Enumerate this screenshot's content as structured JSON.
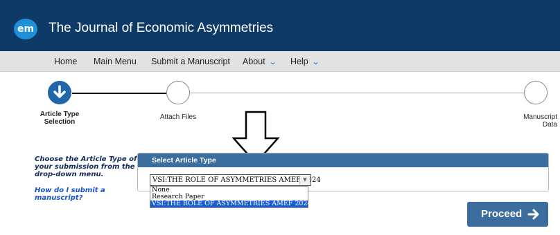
{
  "header": {
    "logo_text": "em",
    "journal_title": "The Journal of Economic Asymmetries",
    "bg_color": "#0d3a66"
  },
  "nav": {
    "items": [
      {
        "label": "Home"
      },
      {
        "label": "Main Menu"
      },
      {
        "label": "Submit a Manuscript"
      },
      {
        "label": "About",
        "icon": "chevron-down-icon"
      },
      {
        "label": "Help",
        "icon": "chevron-down-icon"
      }
    ]
  },
  "stepper": {
    "steps": [
      {
        "label_line1": "Article Type",
        "label_line2": "Selection",
        "state": "active",
        "icon": "arrow-down-icon"
      },
      {
        "label_line1": "Attach Files",
        "label_line2": "",
        "state": "pending"
      },
      {
        "label_line1": "Manuscript",
        "label_line2": "Data",
        "state": "pending"
      }
    ]
  },
  "instructions": {
    "text": "Choose the Article Type of your submission from the drop-down menu.",
    "help_link": "How do I submit a manuscript?"
  },
  "select_panel": {
    "header": "Select Article Type",
    "selected_value": "VSI:THE ROLE OF ASYMMETRIES AMEF 2024",
    "options": [
      "None",
      "Research Paper",
      "VSI:THE ROLE OF ASYMMETRIES AMEF 2024"
    ],
    "accent_color": "#3b6d9e"
  },
  "actions": {
    "proceed_label": "Proceed"
  }
}
